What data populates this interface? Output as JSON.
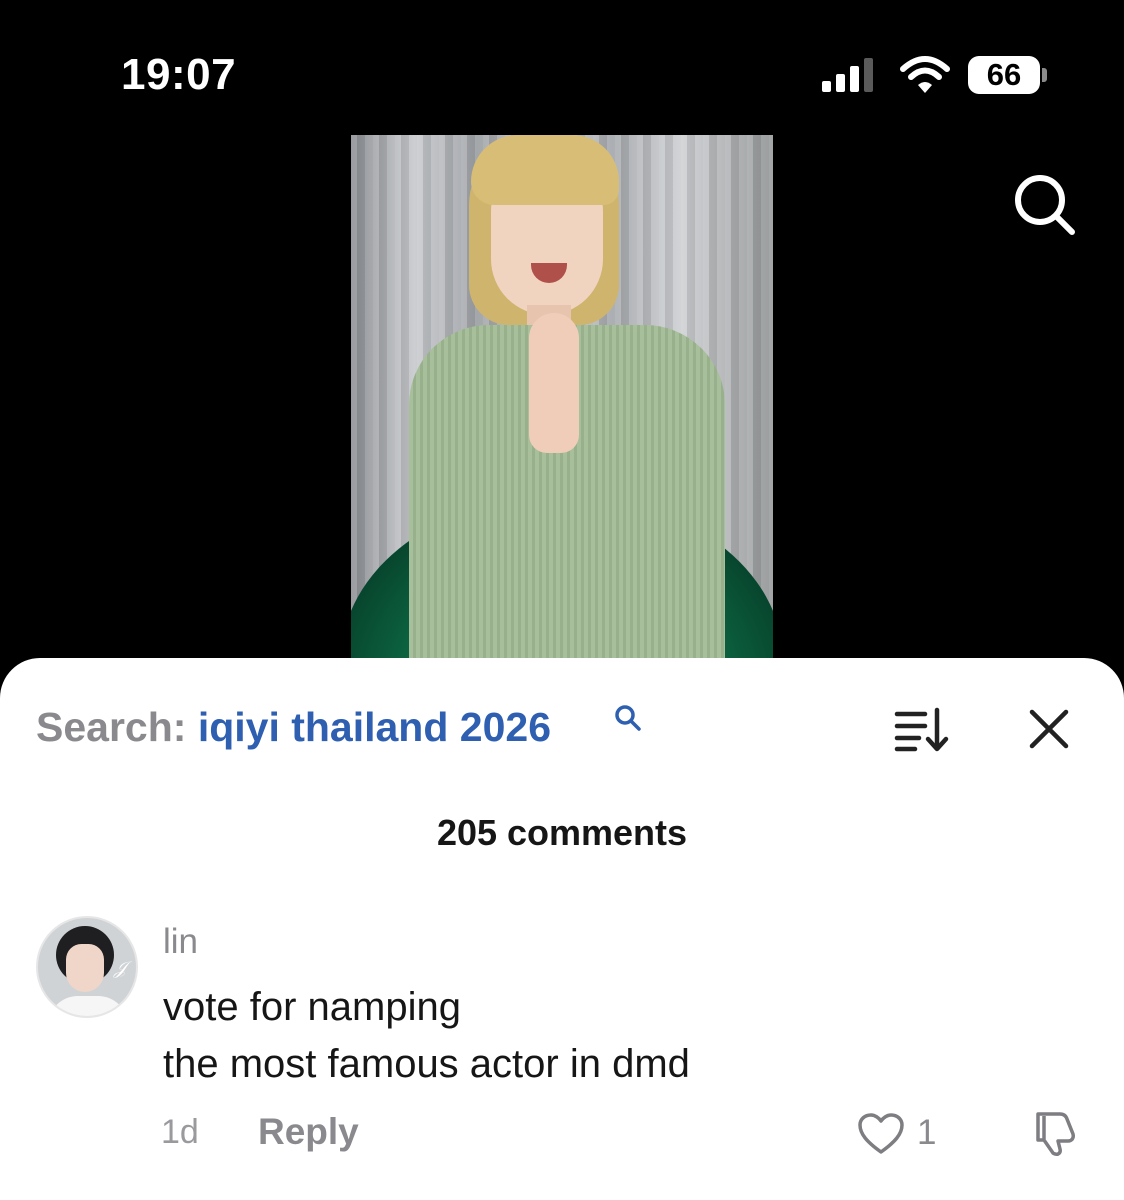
{
  "status_bar": {
    "time": "19:07",
    "battery": "66",
    "icons": [
      "signal-icon",
      "wifi-icon",
      "battery-icon"
    ]
  },
  "top_bar": {
    "search_icon": "search-icon"
  },
  "comments_panel": {
    "search_prefix": "Search: ",
    "search_query": "iqiyi thailand 2026",
    "icons": [
      "search-icon",
      "sort-icon",
      "close-icon"
    ],
    "count_label": "205 comments",
    "accent_color": "#2f5fb0",
    "comments": [
      {
        "username": "lin",
        "line1": "vote for namping",
        "line2": "the most famous actor in dmd",
        "age": "1d",
        "reply_label": "Reply",
        "likes": "1"
      }
    ]
  }
}
